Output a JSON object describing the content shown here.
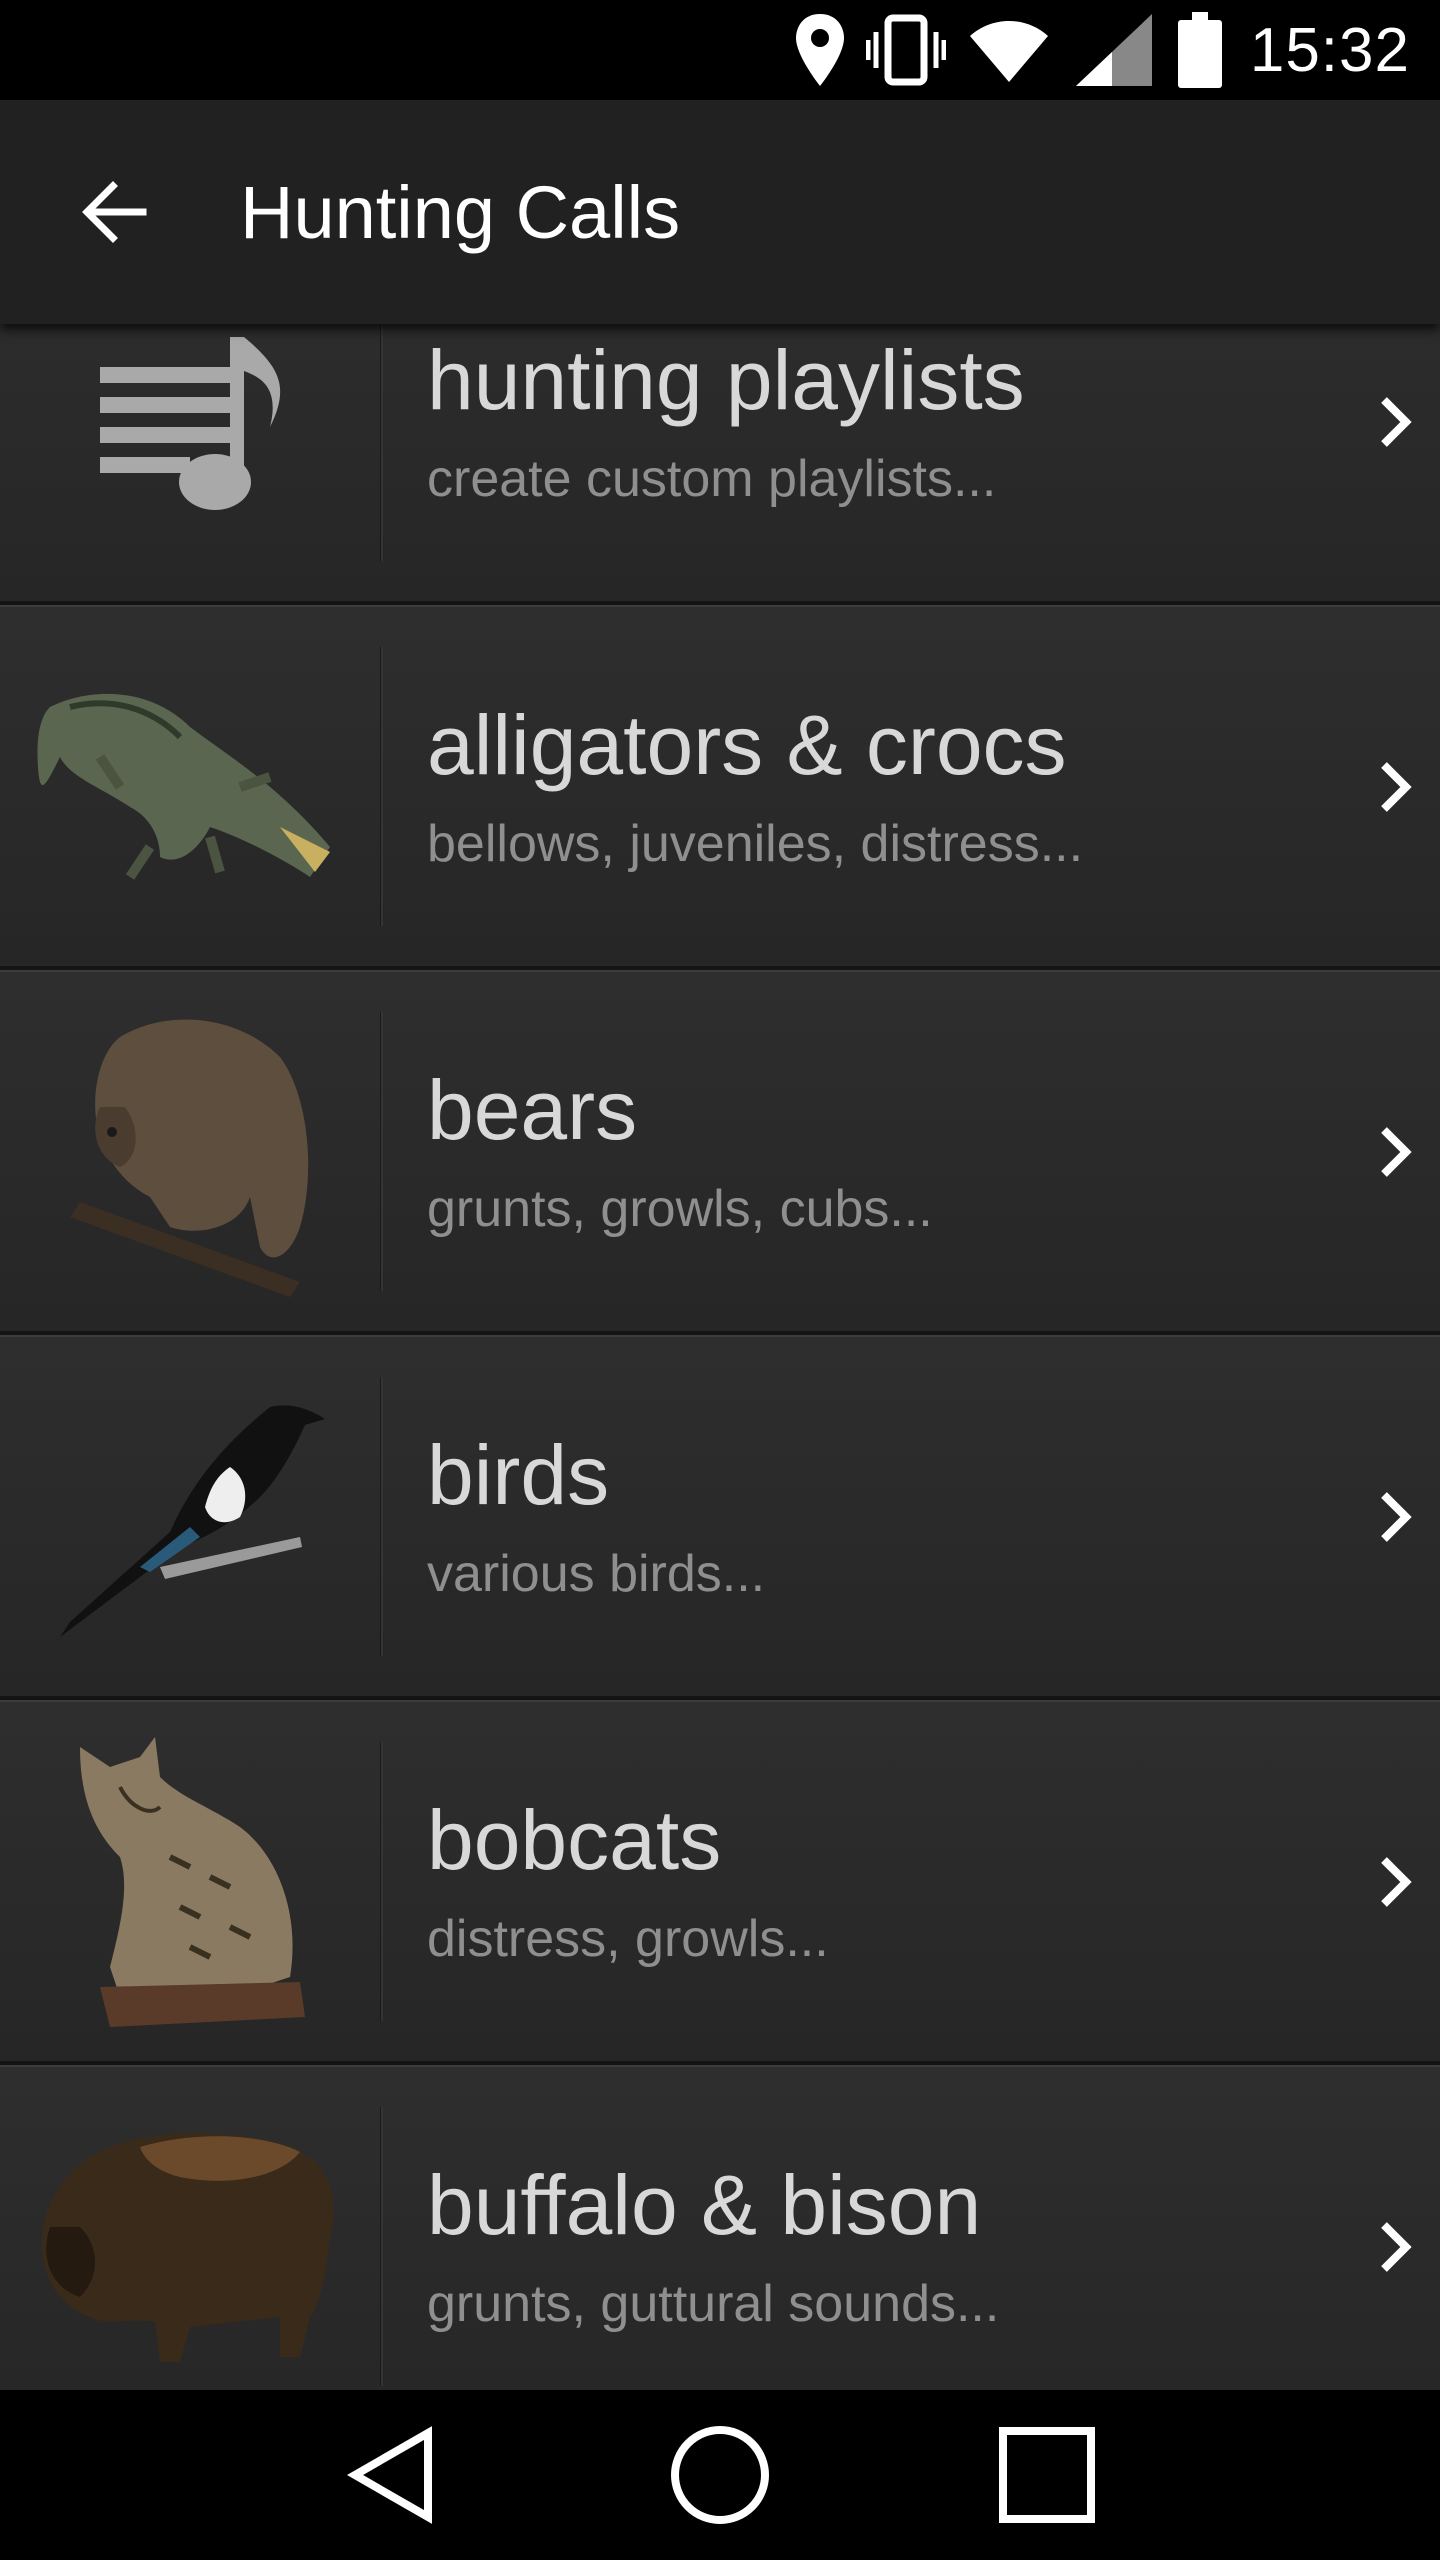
{
  "status_bar": {
    "time": "15:32",
    "icons": [
      "location-icon",
      "vibrate-icon",
      "wifi-icon",
      "signal-icon",
      "battery-icon"
    ]
  },
  "app_bar": {
    "back_icon": "arrow-left-icon",
    "title": "Hunting Calls"
  },
  "list": {
    "items": [
      {
        "title": "hunting playlists",
        "subtitle": "create custom playlists...",
        "icon": "playlist-music-icon"
      },
      {
        "title": "alligators & crocs",
        "subtitle": "bellows, juveniles, distress...",
        "icon": "alligator-image"
      },
      {
        "title": "bears",
        "subtitle": "grunts, growls, cubs...",
        "icon": "bear-image"
      },
      {
        "title": "birds",
        "subtitle": "various birds...",
        "icon": "magpie-image"
      },
      {
        "title": "bobcats",
        "subtitle": "distress, growls...",
        "icon": "bobcat-image"
      },
      {
        "title": "buffalo & bison",
        "subtitle": "grunts, guttural sounds...",
        "icon": "bison-image"
      }
    ]
  },
  "nav_bar": {
    "icons": [
      "back-triangle-icon",
      "home-circle-icon",
      "recents-square-icon"
    ]
  },
  "colors": {
    "app_bar": "#212121",
    "row_bg": "#2a2a2a",
    "title_text": "#d8d8d8",
    "subtitle_text": "#8f8f8f"
  }
}
